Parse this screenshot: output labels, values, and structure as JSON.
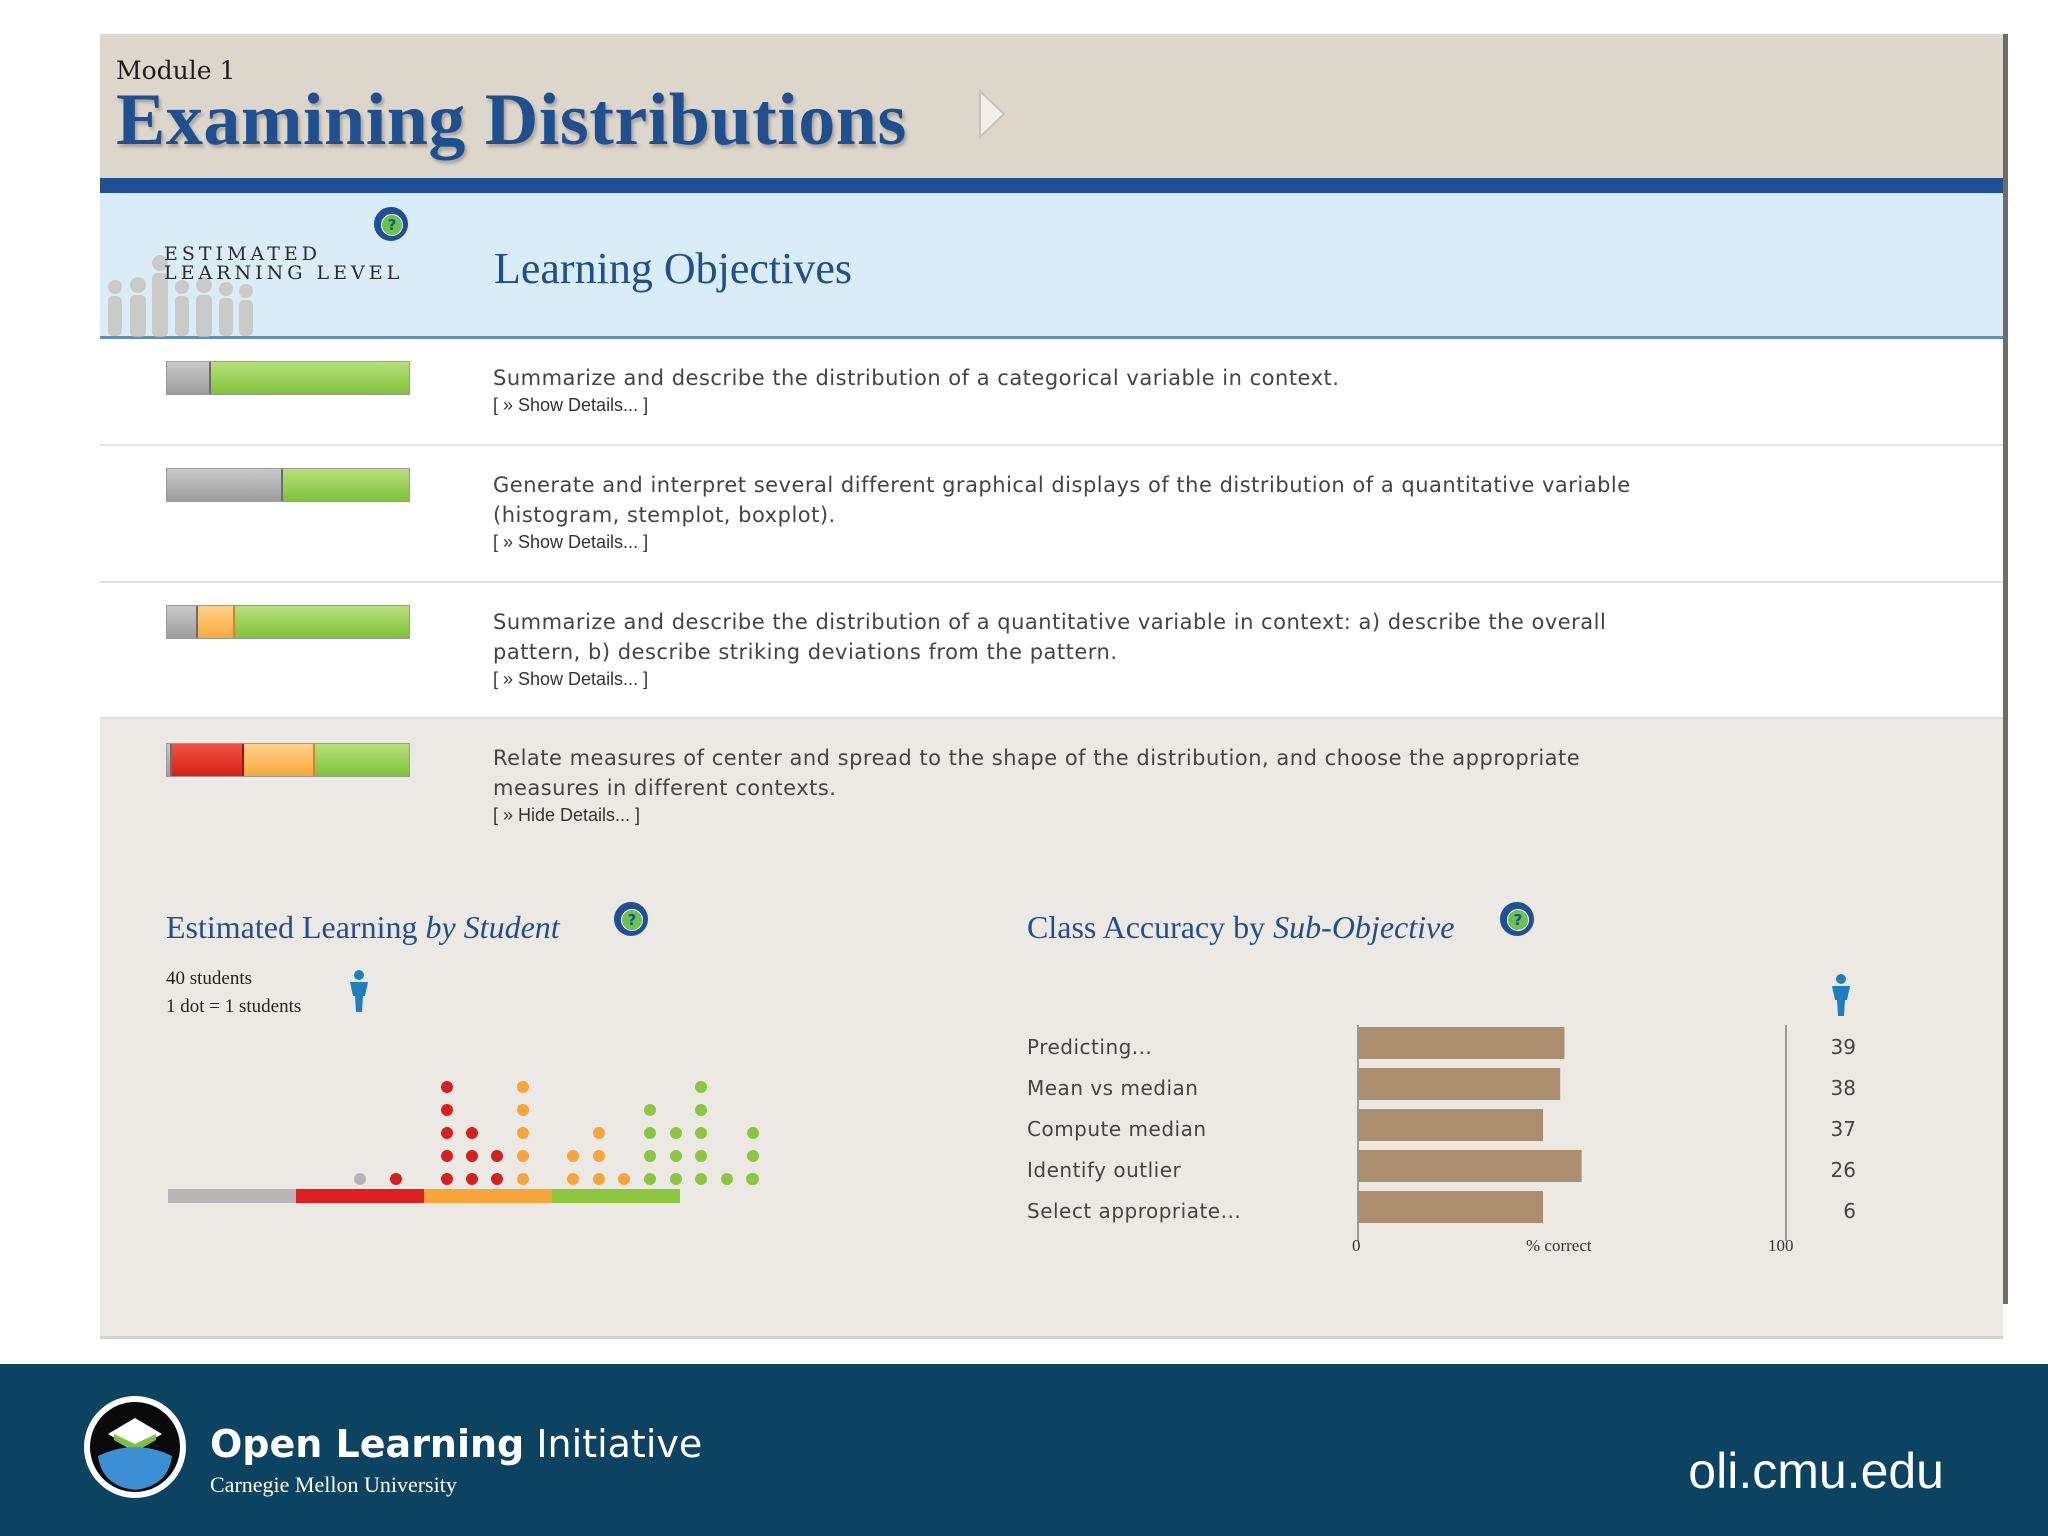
{
  "header": {
    "module_label": "Module 1",
    "module_title": "Examining Distributions"
  },
  "objectives_header": {
    "level_label_line1": "ESTIMATED",
    "level_label_line2": "LEARNING LEVEL",
    "title": "Learning Objectives"
  },
  "objectives": [
    {
      "text": "Summarize and describe the distribution of a categorical variable in context.",
      "details_label": "[ » Show Details... ]",
      "level": {
        "gray": 0.18,
        "orange": 0,
        "red": 0,
        "green": 0.82
      }
    },
    {
      "text": "Generate and interpret several different graphical displays of the distribution of a quantitative variable (histogram, stemplot, boxplot).",
      "details_label": "[ » Show Details... ]",
      "level": {
        "gray": 0.48,
        "orange": 0,
        "red": 0,
        "green": 0.52
      }
    },
    {
      "text": "Summarize and describe the distribution of a quantitative variable in context: a) describe the overall pattern, b) describe striking deviations from the pattern.",
      "details_label": "[ » Show Details... ]",
      "level": {
        "gray": 0.13,
        "orange": 0.15,
        "red": 0,
        "green": 0.72
      }
    },
    {
      "text": "Relate measures of center and spread to the shape of the distribution, and choose the appropriate measures in different contexts.",
      "details_label": "[ » Hide Details... ]",
      "level": {
        "gray": 0.02,
        "orange": 0.29,
        "red": 0.3,
        "green": 0.39
      }
    }
  ],
  "estimated_learning": {
    "title_prefix": "Estimated Learning ",
    "title_emphasis": "by Student",
    "students_count": "40 students",
    "dot_key": "1 dot = 1 students",
    "dot_columns": [
      {
        "color": "#b5b5b5",
        "count": 1
      },
      {
        "color": "#d61f1f",
        "count": 1
      },
      {
        "color": "#d61f1f",
        "count": 5
      },
      {
        "color": "#d61f1f",
        "count": 3
      },
      {
        "color": "#d61f1f",
        "count": 2
      },
      {
        "color": "#f5a53a",
        "count": 5
      },
      {
        "color": "#f5a53a",
        "count": 2
      },
      {
        "color": "#f5a53a",
        "count": 3
      },
      {
        "color": "#f5a53a",
        "count": 1
      },
      {
        "color": "#8cc63f",
        "count": 4
      },
      {
        "color": "#8cc63f",
        "count": 3
      },
      {
        "color": "#8cc63f",
        "count": 5
      },
      {
        "color": "#8cc63f",
        "count": 1
      },
      {
        "color": "#8cc63f",
        "count": 1
      },
      {
        "color": "#8cc63f",
        "count": 3
      }
    ],
    "bands": [
      {
        "color": "#b5b5b5",
        "name": "gray"
      },
      {
        "color": "#e02020",
        "name": "red"
      },
      {
        "color": "#f5a53a",
        "name": "orange"
      },
      {
        "color": "#8cc63f",
        "name": "green"
      }
    ]
  },
  "class_accuracy": {
    "title_prefix": "Class Accuracy by ",
    "title_emphasis": "Sub-Objective",
    "axis_min_label": "0",
    "axis_mid_label": "% correct",
    "axis_max_label": "100",
    "bar_color": "#ab8e6e"
  },
  "chart_data": {
    "type": "bar",
    "orientation": "horizontal",
    "categories": [
      "Predicting...",
      "Mean vs median",
      "Compute median",
      "Identify outlier",
      "Select appropriate..."
    ],
    "values": [
      48,
      47,
      43,
      52,
      43
    ],
    "counts": [
      39,
      38,
      37,
      26,
      6
    ],
    "xlabel": "% correct",
    "xlim": [
      0,
      100
    ]
  },
  "footer": {
    "brand_bold": "Open Learning",
    "brand_light": " Initiative",
    "brand_sub": "Carnegie Mellon University",
    "url": "oli.cmu.edu"
  },
  "colors": {
    "accent_blue": "#1f5096",
    "footer_bg": "#0c4360",
    "header_bg": "#dcd6cb"
  }
}
